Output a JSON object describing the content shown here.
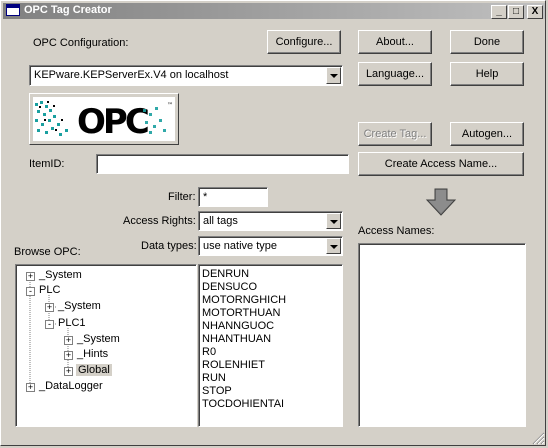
{
  "window": {
    "title": "OPC Tag Creator",
    "minimize_glyph": "_",
    "maximize_glyph": "□",
    "close_glyph": "X"
  },
  "config": {
    "label": "OPC Configuration:",
    "server_value": "KEPware.KEPServerEx.V4 on localhost"
  },
  "buttons": {
    "configure": "Configure...",
    "about": "About...",
    "done": "Done",
    "language": "Language...",
    "help": "Help",
    "create_tag": "Create Tag...",
    "autogen": "Autogen...",
    "create_access_name": "Create Access Name..."
  },
  "itemid": {
    "label": "ItemID:",
    "value": ""
  },
  "filter": {
    "label": "Filter:",
    "value": "*"
  },
  "access_rights": {
    "label": "Access Rights:",
    "value": "all tags"
  },
  "data_types": {
    "label": "Data types:",
    "value": "use native type"
  },
  "browse": {
    "label": "Browse OPC:",
    "tree": [
      {
        "label": "_System",
        "expander": "+"
      },
      {
        "label": "PLC",
        "expander": "-"
      },
      {
        "label": "_System",
        "expander": "+"
      },
      {
        "label": "PLC1",
        "expander": "-"
      },
      {
        "label": "_System",
        "expander": "+"
      },
      {
        "label": "_Hints",
        "expander": "+"
      },
      {
        "label": "Global",
        "expander": "+"
      },
      {
        "label": "_DataLogger",
        "expander": "+"
      }
    ]
  },
  "tags": [
    "DENRUN",
    "DENSUCO",
    "MOTORNGHICH",
    "MOTORTHUAN",
    "NHANNGUOC",
    "NHANTHUAN",
    "R0",
    "ROLENHIET",
    "RUN",
    "STOP",
    "TOCDOHIENTAI"
  ],
  "access_names": {
    "label": "Access Names:",
    "items": []
  },
  "logo": {
    "text": "OPC"
  },
  "colors": {
    "face": "#d4d0c8",
    "titlebar_start": "#808080",
    "titlebar_end": "#c0c0c0",
    "logo_teal": "#1aa0a0"
  }
}
